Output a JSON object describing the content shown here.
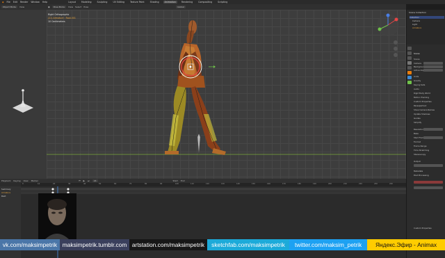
{
  "topbar": {
    "menus": [
      "File",
      "Edit",
      "Render",
      "Window",
      "Help"
    ],
    "workspaces": [
      "Layout",
      "Modeling",
      "Sculpting",
      "UV Editing",
      "Texture Paint",
      "Shading",
      "Animation",
      "Rendering",
      "Compositing",
      "Scripting"
    ],
    "active_workspace": "Animation"
  },
  "left_header": {
    "mode": "Object Mode",
    "view": "View"
  },
  "viewport": {
    "header": {
      "mode": "Pose Mode",
      "items": [
        "View",
        "Select",
        "Pose"
      ],
      "transform": "Global"
    },
    "info": {
      "view_name": "Right Orthographic",
      "collection": "(21) Armature : Root.001",
      "units": "10 Centimeters"
    }
  },
  "outliner": {
    "title": "Scene Collection",
    "items": [
      "Collection",
      "Camera",
      "Light",
      "Armature"
    ]
  },
  "properties": {
    "section": "Scene",
    "rows": [
      "Scene",
      "Camera",
      "Background",
      "Active Clip",
      "Units",
      "Gravity",
      "Keying Sets",
      "Audio",
      "Rigid Body World",
      "Motion Tracking",
      "Custom Properties",
      "Passepartout",
      "Show Camera Names",
      "Update Shadows",
      "Guides",
      "Simplify",
      "Resolution",
      "Bake",
      "Start Frame",
      "Format",
      "Frame Range",
      "Time Stretching",
      "Stereoscopy",
      "Output",
      "Metadata",
      "Post Processing",
      "Custom Properties"
    ]
  },
  "timeline": {
    "header": [
      "Playback",
      "Keying",
      "View",
      "Marker"
    ],
    "frame_current": "24",
    "start_label": "Start",
    "end_label": "End",
    "ticks": [
      "0",
      "10",
      "20",
      "30",
      "40",
      "50",
      "60",
      "70",
      "80",
      "90",
      "100",
      "110",
      "120",
      "130",
      "140",
      "150",
      "160",
      "170",
      "180",
      "190",
      "200",
      "210",
      "220",
      "230",
      "240"
    ],
    "channels": [
      "Summary",
      "Armature",
      "Root"
    ]
  },
  "footer": [
    {
      "text": "vk.com/maksimpetrik",
      "bg": "#4a76a8"
    },
    {
      "text": "maksimpetrik.tumblr.com",
      "bg": "#3a3f5c"
    },
    {
      "text": "artstation.com/maksimpetrik",
      "bg": "#171717"
    },
    {
      "text": "sketchfab.com/maksimpetrik",
      "bg": "#1caad9"
    },
    {
      "text": "twitter.com/maksim_petrik",
      "bg": "#1da1f2"
    },
    {
      "text": "Яндекс.Эфир - Animax",
      "bg": "#ffcc00",
      "fg": "#111111"
    }
  ]
}
